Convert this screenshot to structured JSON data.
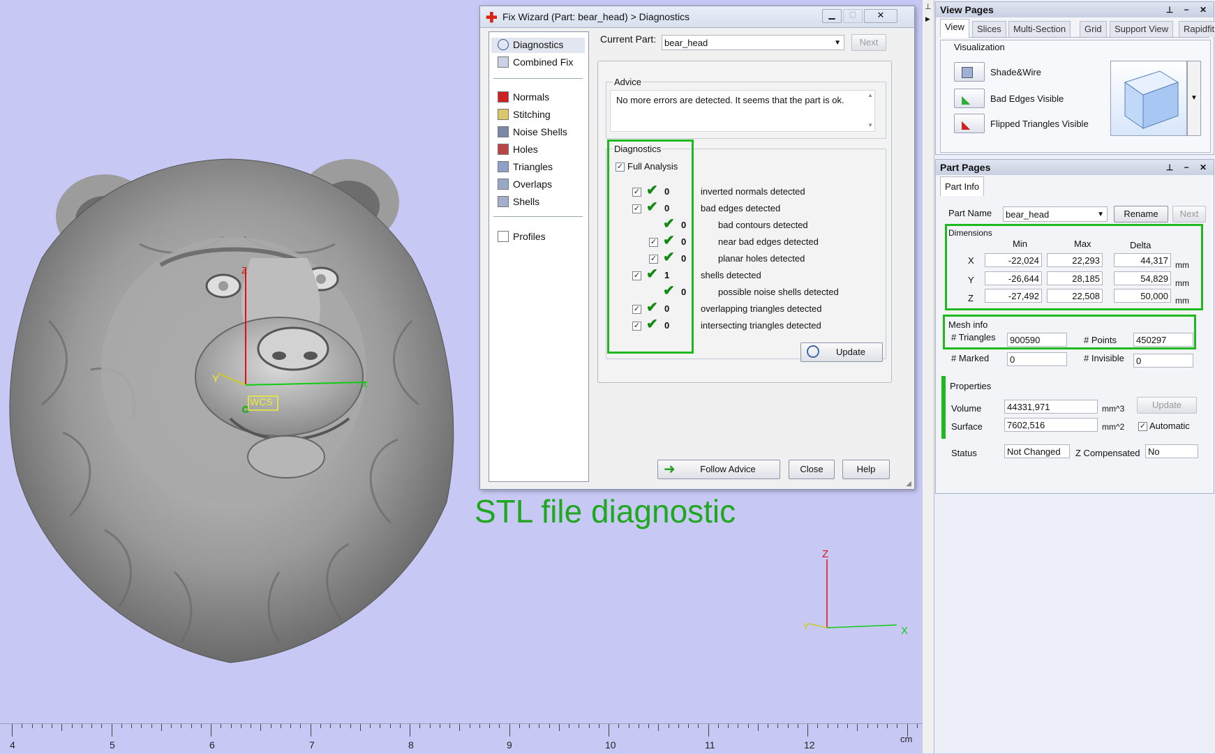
{
  "dialog": {
    "title": "Fix Wizard (Part: bear_head) > Diagnostics",
    "current_part_label": "Current Part:",
    "current_part_value": "bear_head",
    "next_label": "Next",
    "nav": {
      "diagnostics": "Diagnostics",
      "combined_fix": "Combined Fix",
      "normals": "Normals",
      "stitching": "Stitching",
      "noise_shells": "Noise Shells",
      "holes": "Holes",
      "triangles": "Triangles",
      "overlaps": "Overlaps",
      "shells": "Shells",
      "profiles": "Profiles"
    },
    "advice_title": "Advice",
    "advice_text": "No more errors are detected. It seems that the part is ok.",
    "diagnostics_title": "Diagnostics",
    "full_analysis": "Full Analysis",
    "rows": [
      {
        "count": "0",
        "text": "inverted normals detected"
      },
      {
        "count": "0",
        "text": "bad edges detected"
      },
      {
        "count": "0",
        "text": "bad contours detected"
      },
      {
        "count": "0",
        "text": "near bad edges detected"
      },
      {
        "count": "0",
        "text": "planar holes detected"
      },
      {
        "count": "1",
        "text": "shells detected"
      },
      {
        "count": "0",
        "text": "possible noise shells detected"
      },
      {
        "count": "0",
        "text": "overlapping triangles detected"
      },
      {
        "count": "0",
        "text": "intersecting triangles detected"
      }
    ],
    "update_label": "Update",
    "follow_advice_label": "Follow Advice",
    "close_label": "Close",
    "help_label": "Help"
  },
  "caption": "STL file diagnostic",
  "viewport": {
    "wcs_label": "WCS",
    "axis_z": "Z",
    "axis_y": "Y",
    "axis_x": "X",
    "ruler_labels": [
      "4",
      "5",
      "6",
      "7",
      "8",
      "9",
      "10",
      "11",
      "12"
    ],
    "ruler_unit": "cm"
  },
  "view_pages": {
    "title": "View Pages",
    "tabs": [
      "View",
      "Slices",
      "Multi-Section",
      "Grid",
      "Support View",
      "Rapidfit View"
    ],
    "group": "Visualization",
    "items": [
      "Shade&Wire",
      "Bad Edges Visible",
      "Flipped Triangles Visible"
    ]
  },
  "part_pages": {
    "title": "Part Pages",
    "tab": "Part Info",
    "part_name_label": "Part Name",
    "part_name_value": "bear_head",
    "rename_label": "Rename",
    "next_label": "Next",
    "dimensions": {
      "title": "Dimensions",
      "headers": [
        "Min",
        "Max",
        "Delta"
      ],
      "rows": [
        {
          "axis": "X",
          "min": "-22,024",
          "max": "22,293",
          "delta": "44,317",
          "unit": "mm"
        },
        {
          "axis": "Y",
          "min": "-26,644",
          "max": "28,185",
          "delta": "54,829",
          "unit": "mm"
        },
        {
          "axis": "Z",
          "min": "-27,492",
          "max": "22,508",
          "delta": "50,000",
          "unit": "mm"
        }
      ]
    },
    "mesh": {
      "title": "Mesh info",
      "triangles_label": "# Triangles",
      "triangles": "900590",
      "points_label": "# Points",
      "points": "450297",
      "marked_label": "# Marked",
      "marked": "0",
      "invisible_label": "# Invisible",
      "invisible": "0"
    },
    "properties": {
      "title": "Properties",
      "volume_label": "Volume",
      "volume": "44331,971",
      "volume_unit": "mm^3",
      "surface_label": "Surface",
      "surface": "7602,516",
      "surface_unit": "mm^2",
      "update_label": "Update",
      "automatic_label": "Automatic"
    },
    "status_label": "Status",
    "status_value": "Not Changed",
    "zcomp_label": "Z Compensated",
    "zcomp_value": "No"
  }
}
